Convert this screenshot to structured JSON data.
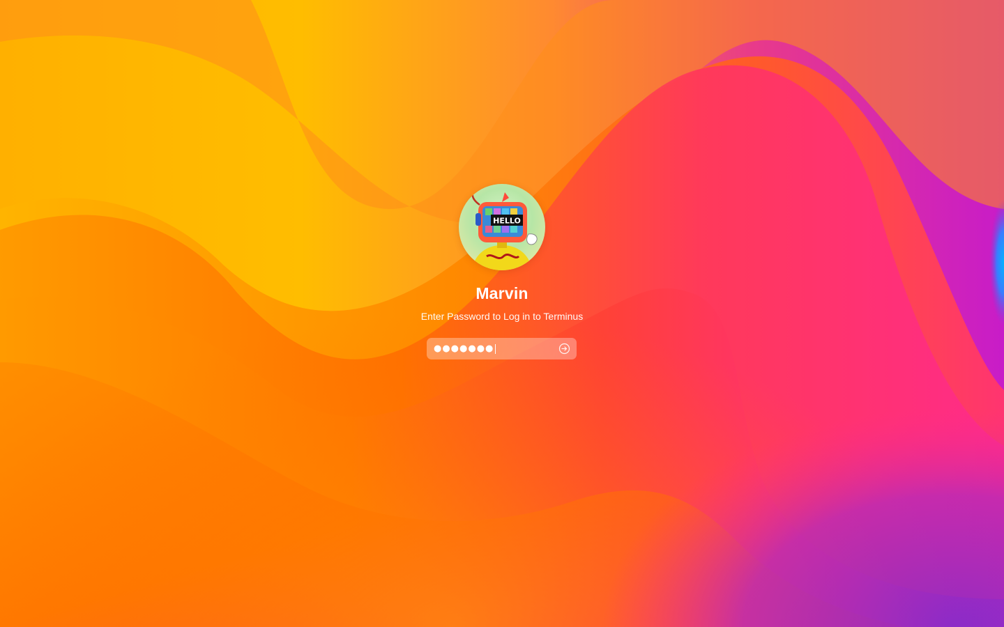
{
  "login": {
    "username": "Marvin",
    "prompt": "Enter Password to Log in to Terminus",
    "password_mask": "●●●●●●●",
    "password_length": 7,
    "avatar_badge_text": "HELLO"
  },
  "icons": {
    "submit": "arrow-circle-right-icon",
    "avatar": "robot-tv-head-avatar"
  },
  "colors": {
    "orange": "#ff8a00",
    "red": "#ff3b4f",
    "magenta": "#e020a8",
    "purple": "#c31fd0",
    "blue": "#1aa0ff",
    "text": "#ffffff"
  }
}
